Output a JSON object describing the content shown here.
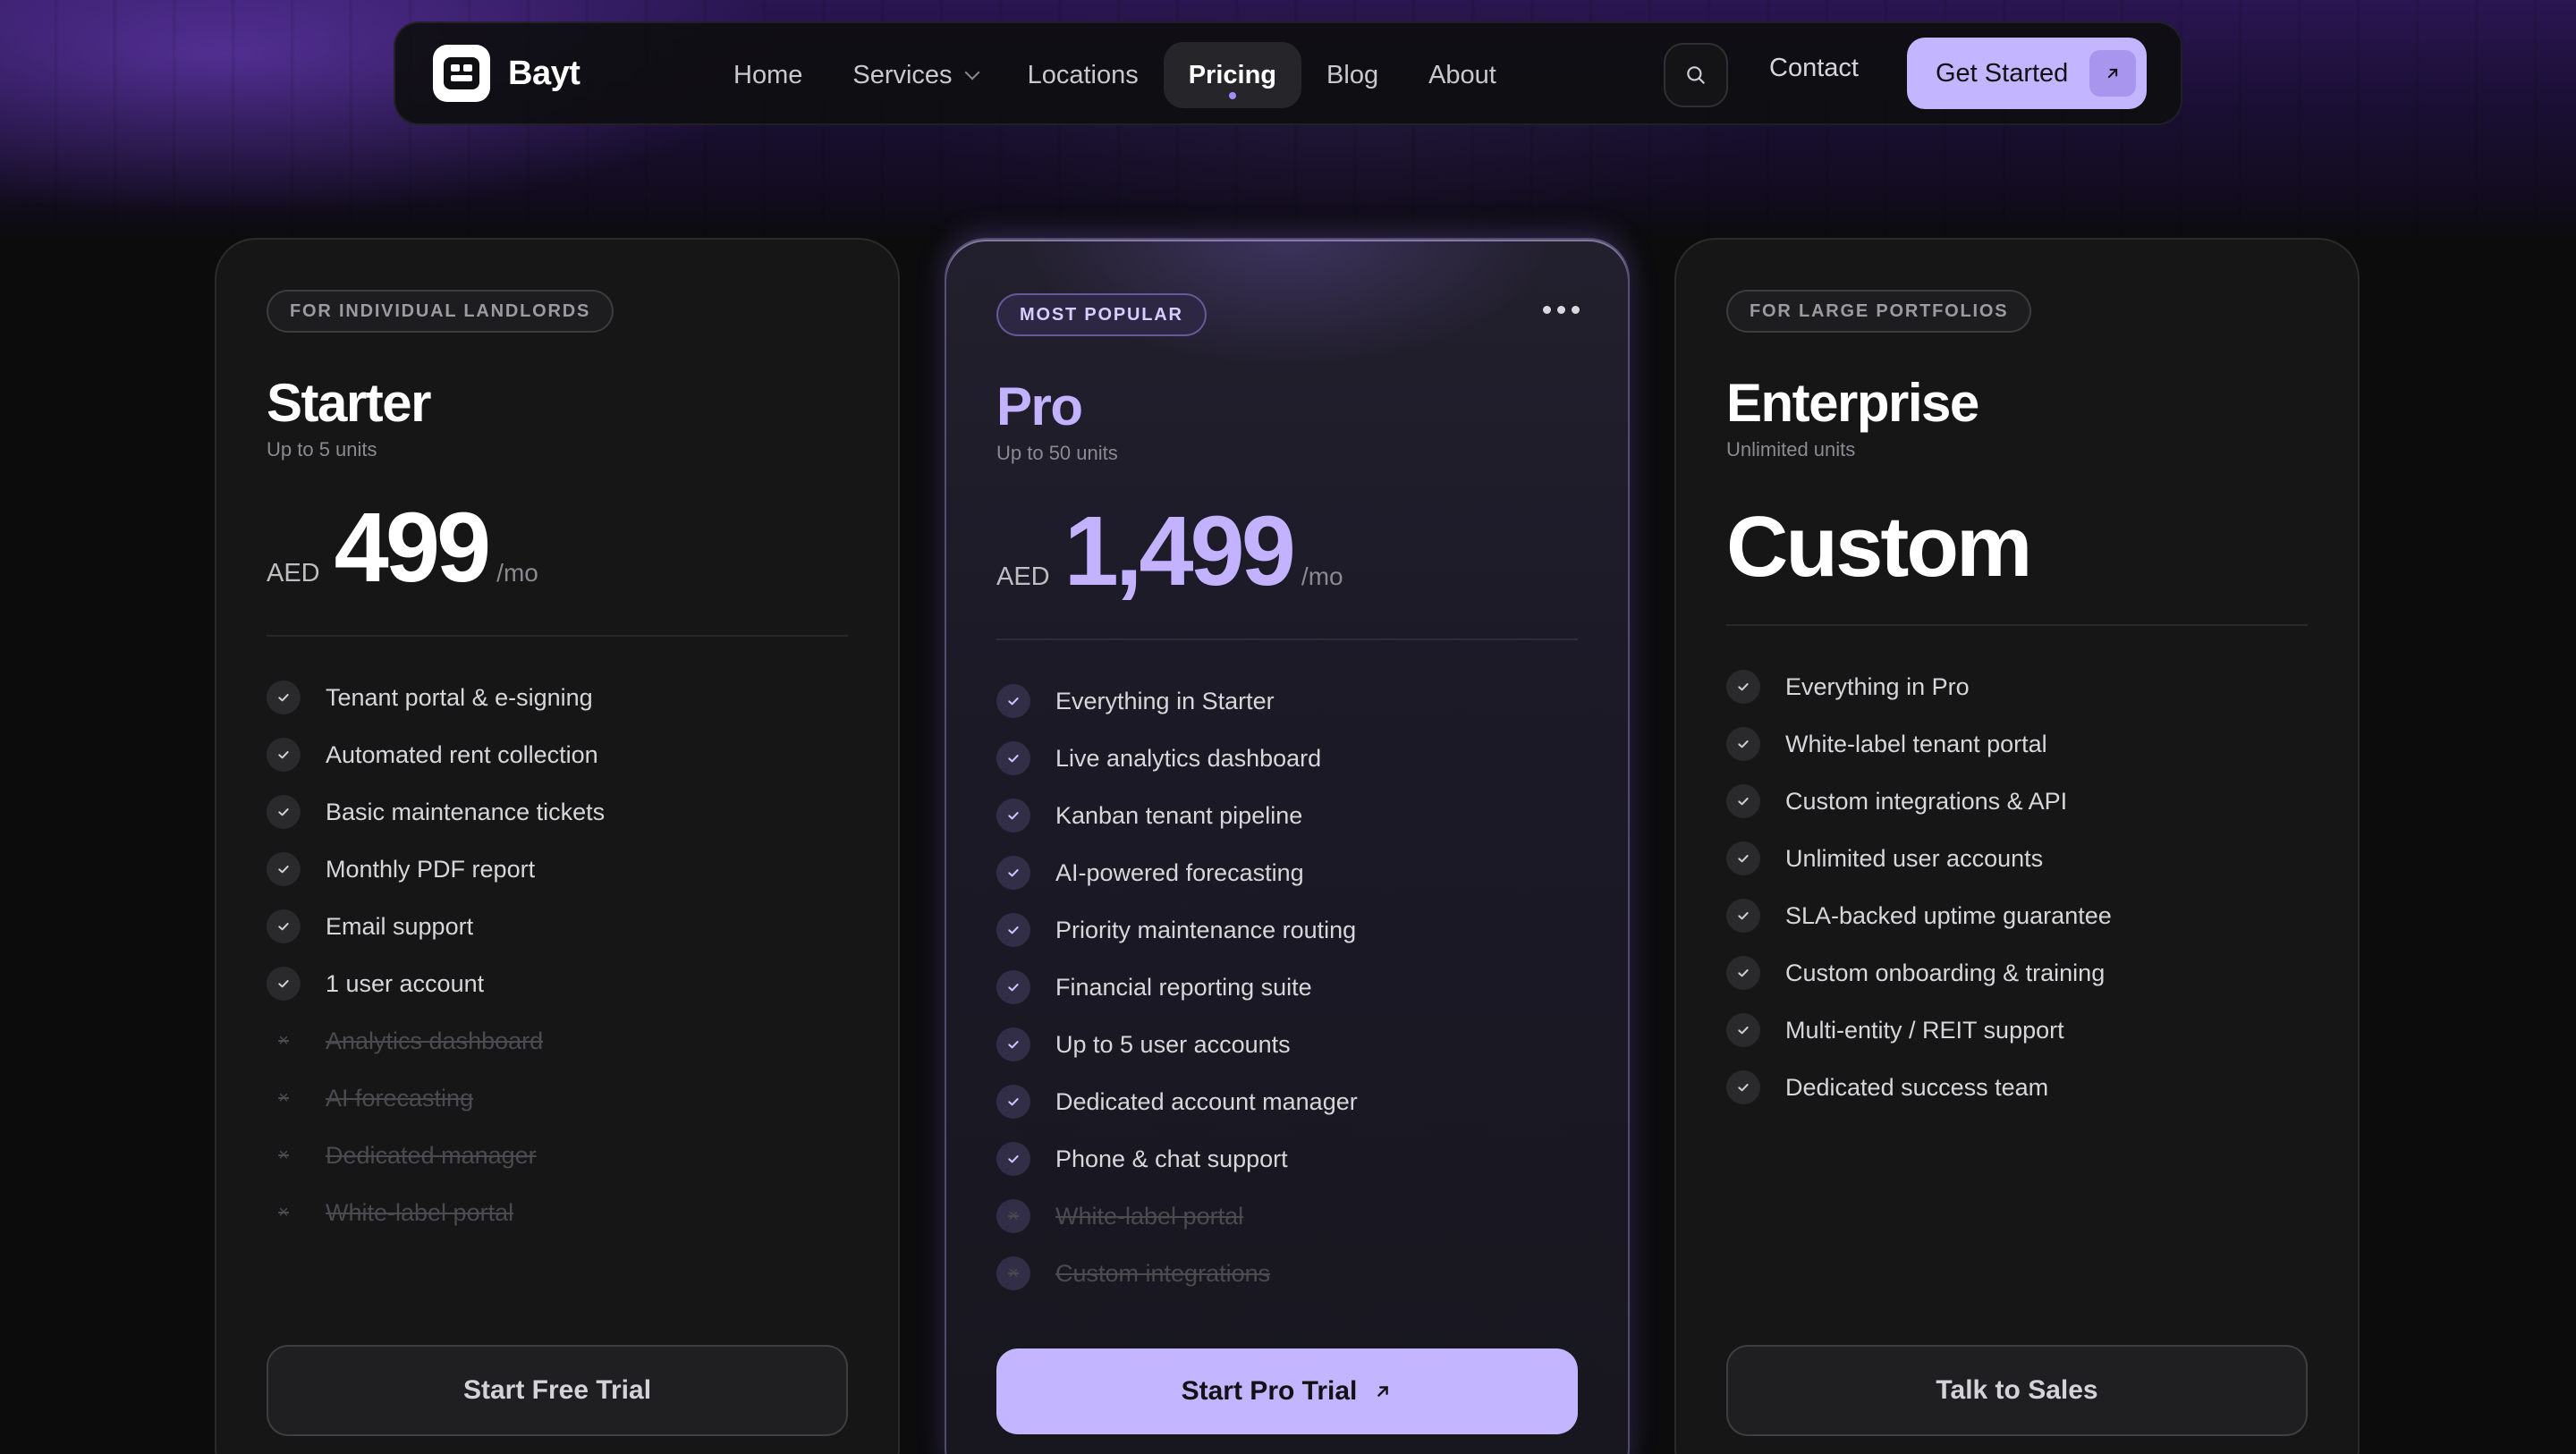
{
  "nav": {
    "brand": "Bayt",
    "links": [
      {
        "label": "Home",
        "active": false
      },
      {
        "label": "Services",
        "active": false,
        "dropdown": true
      },
      {
        "label": "Locations",
        "active": false
      },
      {
        "label": "Pricing",
        "active": true
      },
      {
        "label": "Blog",
        "active": false
      },
      {
        "label": "About",
        "active": false
      }
    ],
    "search_icon": "search-icon",
    "contact": "Contact",
    "cta": "Get Started",
    "cta_icon": "arrow-up-right-icon"
  },
  "colors": {
    "accent": "#c3b5ff",
    "accent_text": "#c2b2ff",
    "background": "#0c0c0d",
    "card": "#161617"
  },
  "plans": [
    {
      "tag": "FOR INDIVIDUAL LANDLORDS",
      "name": "Starter",
      "units": "Up to 5 units",
      "currency": "AED",
      "price": "499",
      "period": "/mo",
      "features": [
        {
          "label": "Tenant portal & e-signing",
          "included": true
        },
        {
          "label": "Automated rent collection",
          "included": true
        },
        {
          "label": "Basic maintenance tickets",
          "included": true
        },
        {
          "label": "Monthly PDF report",
          "included": true
        },
        {
          "label": "Email support",
          "included": true
        },
        {
          "label": "1 user account",
          "included": true
        },
        {
          "label": "Analytics dashboard",
          "included": false
        },
        {
          "label": "AI forecasting",
          "included": false
        },
        {
          "label": "Dedicated manager",
          "included": false
        },
        {
          "label": "White-label portal",
          "included": false
        }
      ],
      "button": "Start Free Trial"
    },
    {
      "tag": "MOST POPULAR",
      "name": "Pro",
      "units": "Up to 50 units",
      "currency": "AED",
      "price": "1,499",
      "period": "/mo",
      "features": [
        {
          "label": "Everything in Starter",
          "included": true
        },
        {
          "label": "Live analytics dashboard",
          "included": true
        },
        {
          "label": "Kanban tenant pipeline",
          "included": true
        },
        {
          "label": "AI-powered forecasting",
          "included": true
        },
        {
          "label": "Priority maintenance routing",
          "included": true
        },
        {
          "label": "Financial reporting suite",
          "included": true
        },
        {
          "label": "Up to 5 user accounts",
          "included": true
        },
        {
          "label": "Dedicated account manager",
          "included": true
        },
        {
          "label": "Phone & chat support",
          "included": true
        },
        {
          "label": "White-label portal",
          "included": false
        },
        {
          "label": "Custom integrations",
          "included": false
        }
      ],
      "button": "Start Pro Trial",
      "button_icon": "arrow-up-right-icon"
    },
    {
      "tag": "FOR LARGE PORTFOLIOS",
      "name": "Enterprise",
      "units": "Unlimited units",
      "price": "Custom",
      "features": [
        {
          "label": "Everything in Pro",
          "included": true
        },
        {
          "label": "White-label tenant portal",
          "included": true
        },
        {
          "label": "Custom integrations & API",
          "included": true
        },
        {
          "label": "Unlimited user accounts",
          "included": true
        },
        {
          "label": "SLA-backed uptime guarantee",
          "included": true
        },
        {
          "label": "Custom onboarding & training",
          "included": true
        },
        {
          "label": "Multi-entity / REIT support",
          "included": true
        },
        {
          "label": "Dedicated success team",
          "included": true
        }
      ],
      "button": "Talk to Sales"
    }
  ]
}
